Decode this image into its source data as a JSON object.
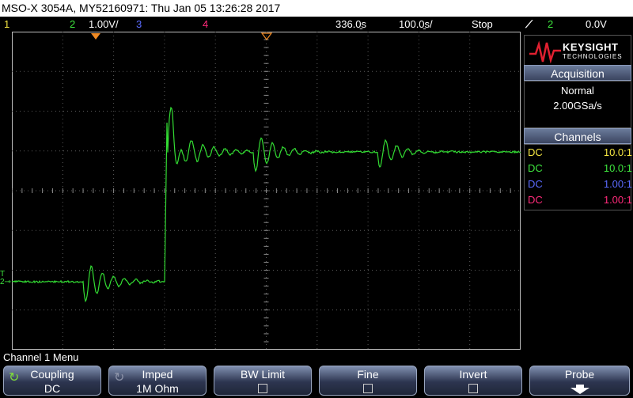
{
  "title_bar": {
    "text": "MSO-X 3054A, MY52160971: Thu Jan 05 13:26:28 2017"
  },
  "status": {
    "ch1_num": "1",
    "ch2_num": "2",
    "ch2_scale": "1.00V/",
    "ch3_num": "3",
    "ch4_num": "4",
    "delay": "336.0̱s",
    "timebase": "100.0̱s/",
    "run_state": "Stop",
    "trigger_icon": "trigger-edge-icon",
    "trigger_source": "2",
    "trigger_level": "0.0V"
  },
  "brand": {
    "name": "KEYSIGHT",
    "sub": "TECHNOLOGIES"
  },
  "acquisition": {
    "header": "Acquisition",
    "mode": "Normal",
    "rate": "2.00GSa/s"
  },
  "channels": {
    "header": "Channels",
    "rows": [
      {
        "coupling": "DC",
        "probe": "10.0:1",
        "color": "#f5e642"
      },
      {
        "coupling": "DC",
        "probe": "10.0:1",
        "color": "#3ee63e"
      },
      {
        "coupling": "DC",
        "probe": "1.00:1",
        "color": "#5b6bff"
      },
      {
        "coupling": "DC",
        "probe": "1.00:1",
        "color": "#ff2a7a"
      }
    ]
  },
  "menu": {
    "title": "Channel 1 Menu"
  },
  "softkeys": [
    {
      "label": "Coupling",
      "value": "DC"
    },
    {
      "label": "Imped",
      "value": "1M Ohm"
    },
    {
      "label": "BW Limit",
      "value": ""
    },
    {
      "label": "Fine",
      "value": ""
    },
    {
      "label": "Invert",
      "value": ""
    },
    {
      "label": "Probe",
      "value": ""
    }
  ],
  "colors": {
    "ch1": "#f5e642",
    "ch2": "#3ee63e",
    "ch3": "#5b6bff",
    "ch4": "#ff2a7a",
    "trace": "#33dd33",
    "marker": "#f08a24"
  }
}
